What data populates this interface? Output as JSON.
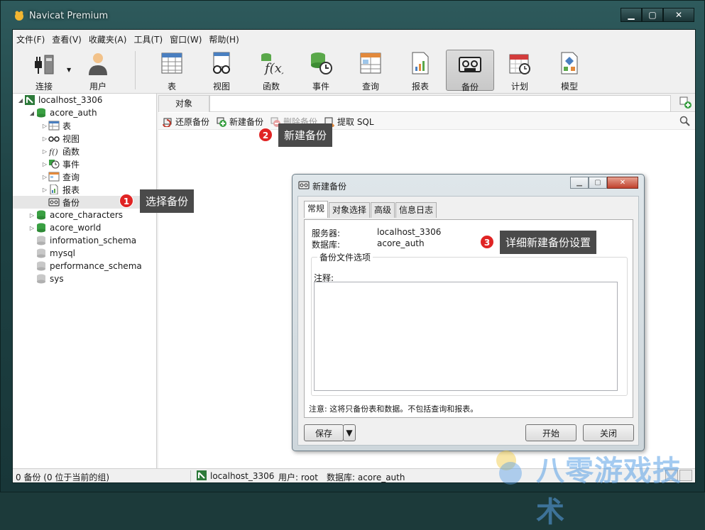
{
  "window": {
    "title": "Navicat Premium"
  },
  "menu": [
    "文件(F)",
    "查看(V)",
    "收藏夹(A)",
    "工具(T)",
    "窗口(W)",
    "帮助(H)"
  ],
  "toolbar": {
    "connect": "连接",
    "user": "用户",
    "table": "表",
    "view": "视图",
    "function": "函数",
    "event": "事件",
    "query": "查询",
    "report": "报表",
    "backup": "备份",
    "schedule": "计划",
    "model": "模型"
  },
  "tree": {
    "connection": "localhost_3306",
    "db_open": "acore_auth",
    "children": [
      "表",
      "视图",
      "函数",
      "事件",
      "查询",
      "报表",
      "备份"
    ],
    "dbs": [
      "acore_characters",
      "acore_world",
      "information_schema",
      "mysql",
      "performance_schema",
      "sys"
    ]
  },
  "tabs": {
    "objects": "对象"
  },
  "subtoolbar": {
    "restore": "还原备份",
    "new": "新建备份",
    "delete": "删除备份",
    "extract": "提取 SQL"
  },
  "dialog": {
    "title": "新建备份",
    "tabs": [
      "常规",
      "对象选择",
      "高级",
      "信息日志"
    ],
    "server_label": "服务器:",
    "server_value": "localhost_3306",
    "db_label": "数据库:",
    "db_value": "acore_auth",
    "group_title": "备份文件选项",
    "comment_label": "注释:",
    "note": "注意: 这将只备份表和数据。不包括查询和报表。",
    "save": "保存",
    "start": "开始",
    "close": "关闭"
  },
  "status": {
    "left": "0 备份 (0 位于当前的组)",
    "connection": "localhost_3306",
    "user": "用户: root",
    "database": "数据库: acore_auth"
  },
  "annotations": [
    {
      "num": "1",
      "text": "选择备份"
    },
    {
      "num": "2",
      "text": "新建备份"
    },
    {
      "num": "3",
      "text": "详细新建备份设置"
    }
  ],
  "watermark": "八零游戏技术",
  "colors": {
    "badge": "#e02424",
    "callout": "#4a4a4a",
    "db_green": "#3aa043"
  }
}
